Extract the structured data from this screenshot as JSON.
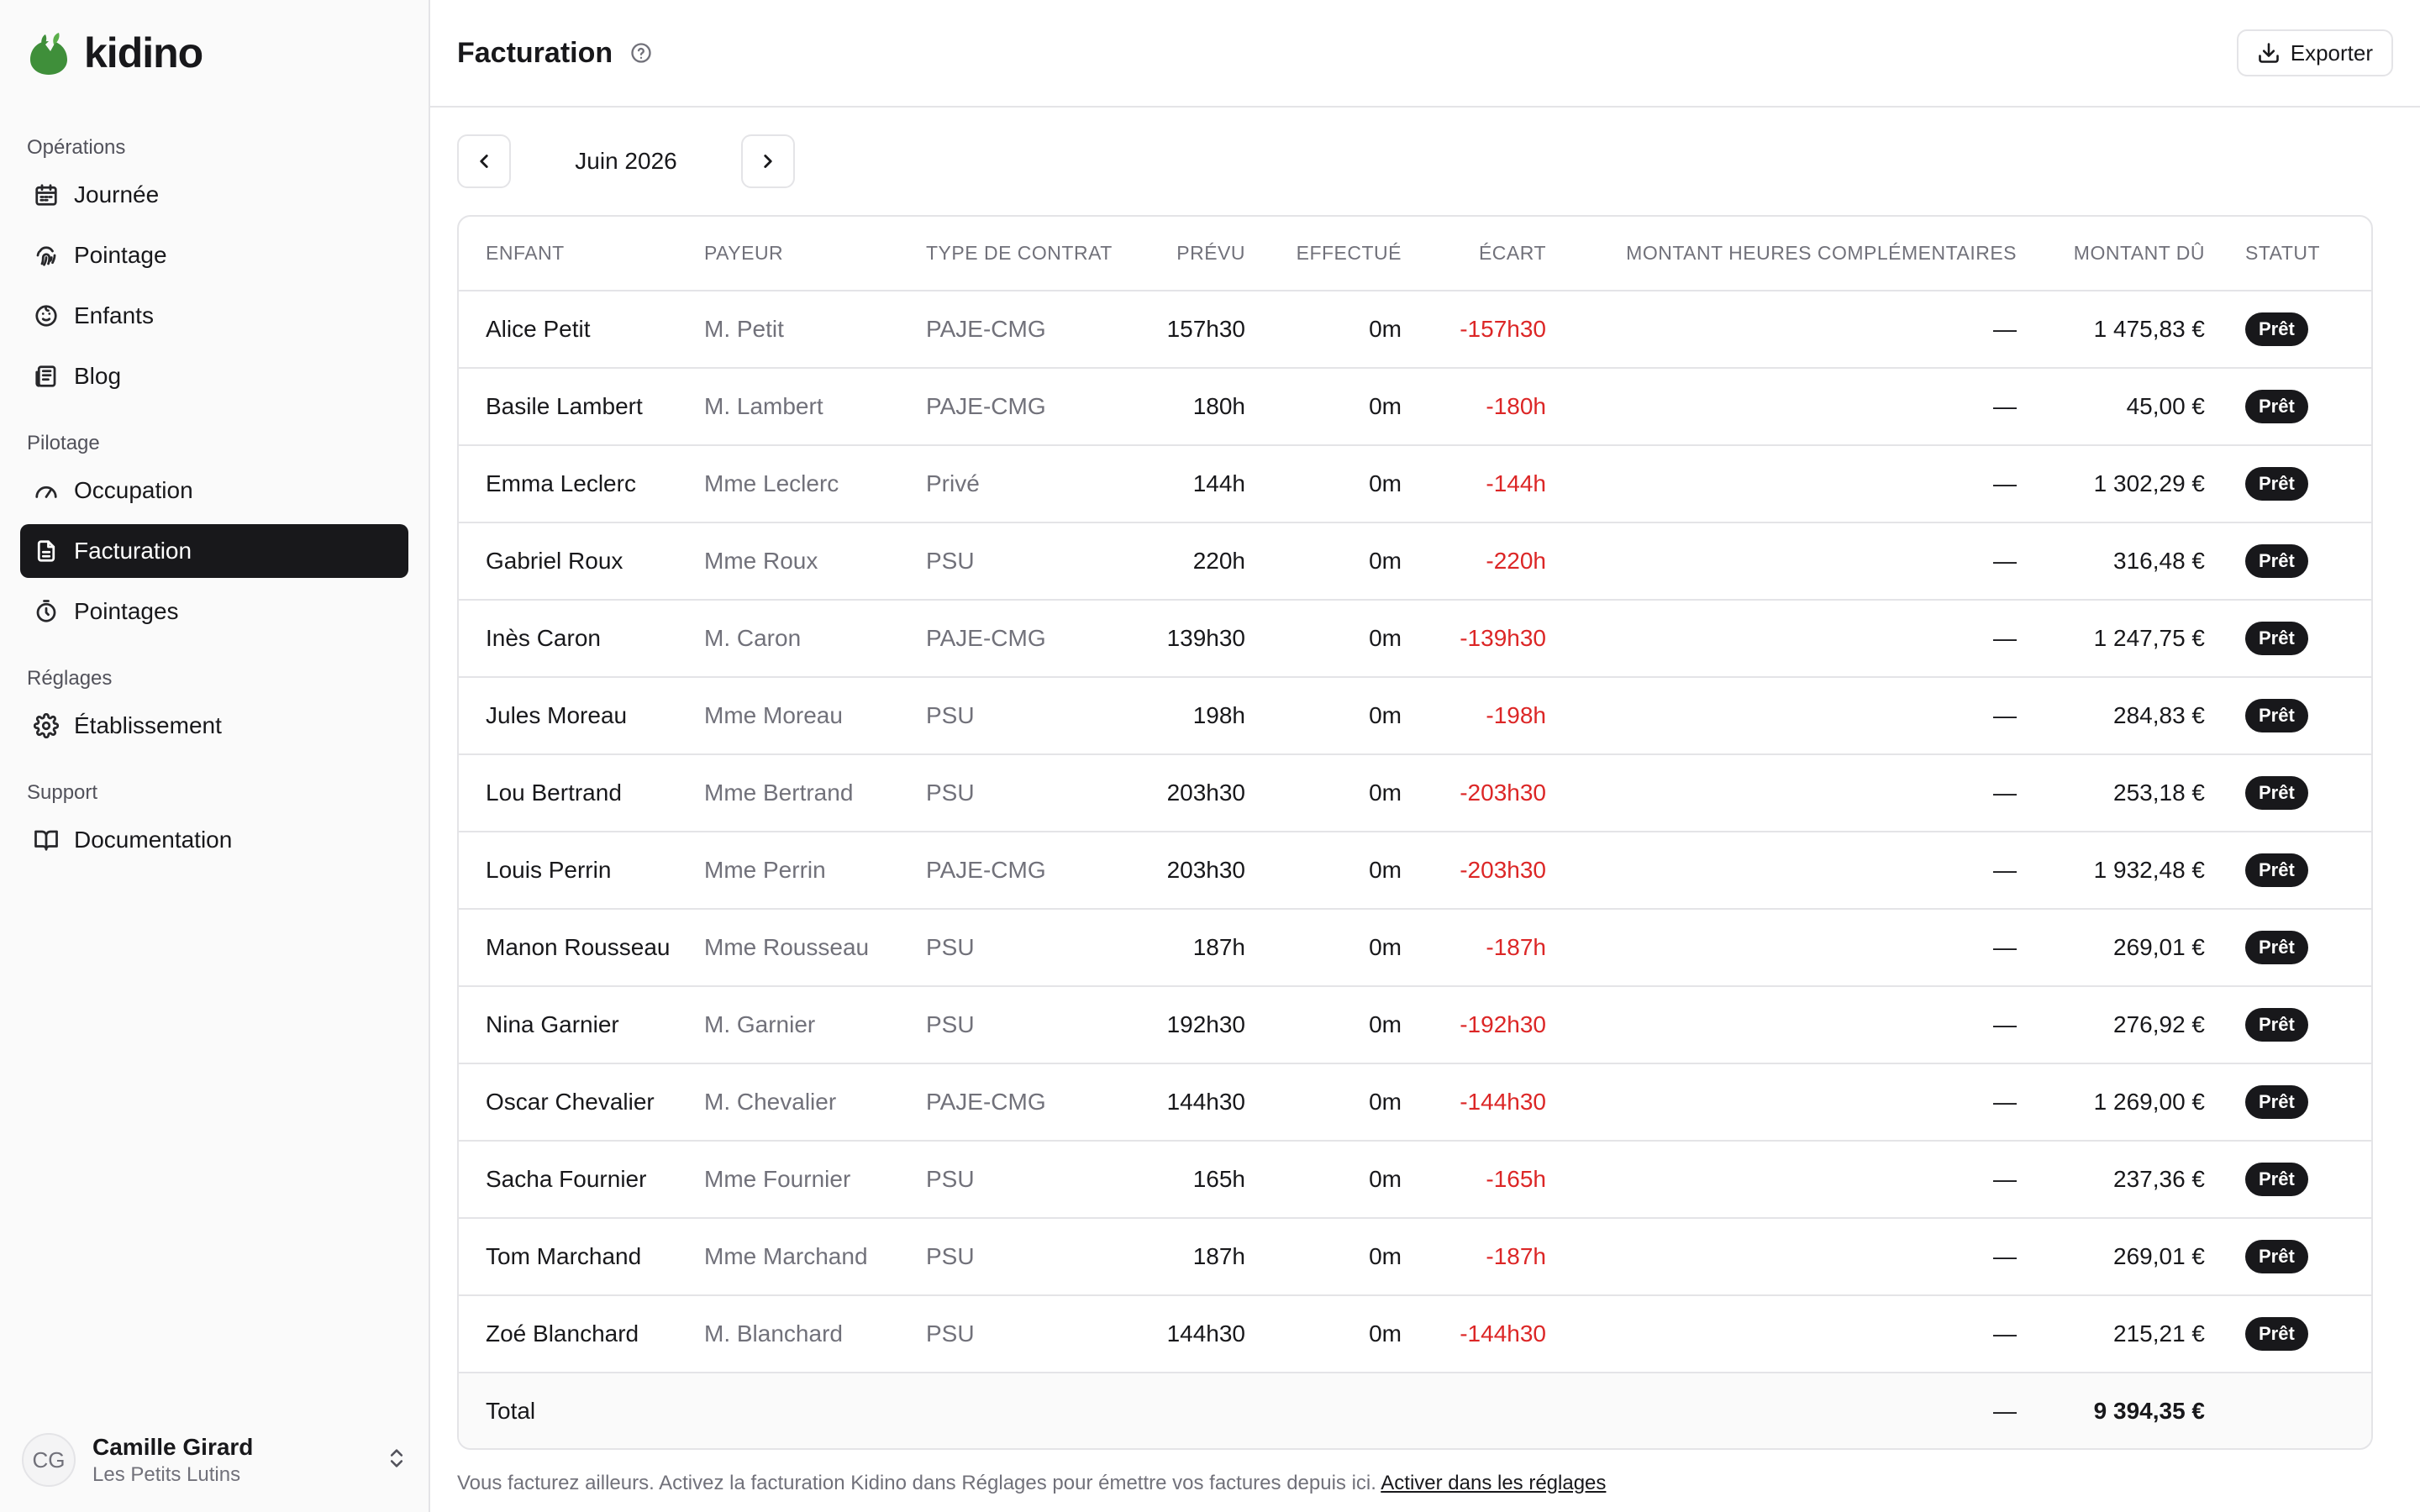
{
  "brand": {
    "name": "kidino",
    "color": "#3f8f3a"
  },
  "sidebar": {
    "sections": [
      {
        "label": "Opérations",
        "items": [
          {
            "label": "Journée",
            "icon": "calendar-icon"
          },
          {
            "label": "Pointage",
            "icon": "fingerprint-icon"
          },
          {
            "label": "Enfants",
            "icon": "baby-face-icon"
          },
          {
            "label": "Blog",
            "icon": "newspaper-icon"
          }
        ]
      },
      {
        "label": "Pilotage",
        "items": [
          {
            "label": "Occupation",
            "icon": "gauge-icon"
          },
          {
            "label": "Facturation",
            "icon": "document-icon",
            "active": true
          },
          {
            "label": "Pointages",
            "icon": "timer-icon"
          }
        ]
      },
      {
        "label": "Réglages",
        "items": [
          {
            "label": "Établissement",
            "icon": "gear-icon"
          }
        ]
      },
      {
        "label": "Support",
        "items": [
          {
            "label": "Documentation",
            "icon": "book-icon"
          }
        ]
      }
    ]
  },
  "user": {
    "initials": "CG",
    "name": "Camille Girard",
    "org": "Les Petits Lutins"
  },
  "header": {
    "title": "Facturation",
    "export_label": "Exporter"
  },
  "period": {
    "label": "Juin 2026"
  },
  "table": {
    "columns": [
      "Enfant",
      "Payeur",
      "Type de contrat",
      "Prévu",
      "Effectué",
      "Écart",
      "Montant heures complémentaires",
      "Montant dû",
      "Statut"
    ],
    "rows": [
      {
        "enfant": "Alice Petit",
        "payeur": "M. Petit",
        "type": "PAJE-CMG",
        "prevu": "157h30",
        "effectue": "0m",
        "ecart": "-157h30",
        "comp": "—",
        "du": "1 475,83 €",
        "statut": "Prêt"
      },
      {
        "enfant": "Basile Lambert",
        "payeur": "M. Lambert",
        "type": "PAJE-CMG",
        "prevu": "180h",
        "effectue": "0m",
        "ecart": "-180h",
        "comp": "—",
        "du": "45,00 €",
        "statut": "Prêt"
      },
      {
        "enfant": "Emma Leclerc",
        "payeur": "Mme Leclerc",
        "type": "Privé",
        "prevu": "144h",
        "effectue": "0m",
        "ecart": "-144h",
        "comp": "—",
        "du": "1 302,29 €",
        "statut": "Prêt"
      },
      {
        "enfant": "Gabriel Roux",
        "payeur": "Mme Roux",
        "type": "PSU",
        "prevu": "220h",
        "effectue": "0m",
        "ecart": "-220h",
        "comp": "—",
        "du": "316,48 €",
        "statut": "Prêt"
      },
      {
        "enfant": "Inès Caron",
        "payeur": "M. Caron",
        "type": "PAJE-CMG",
        "prevu": "139h30",
        "effectue": "0m",
        "ecart": "-139h30",
        "comp": "—",
        "du": "1 247,75 €",
        "statut": "Prêt"
      },
      {
        "enfant": "Jules Moreau",
        "payeur": "Mme Moreau",
        "type": "PSU",
        "prevu": "198h",
        "effectue": "0m",
        "ecart": "-198h",
        "comp": "—",
        "du": "284,83 €",
        "statut": "Prêt"
      },
      {
        "enfant": "Lou Bertrand",
        "payeur": "Mme Bertrand",
        "type": "PSU",
        "prevu": "203h30",
        "effectue": "0m",
        "ecart": "-203h30",
        "comp": "—",
        "du": "253,18 €",
        "statut": "Prêt"
      },
      {
        "enfant": "Louis Perrin",
        "payeur": "Mme Perrin",
        "type": "PAJE-CMG",
        "prevu": "203h30",
        "effectue": "0m",
        "ecart": "-203h30",
        "comp": "—",
        "du": "1 932,48 €",
        "statut": "Prêt"
      },
      {
        "enfant": "Manon Rousseau",
        "payeur": "Mme Rousseau",
        "type": "PSU",
        "prevu": "187h",
        "effectue": "0m",
        "ecart": "-187h",
        "comp": "—",
        "du": "269,01 €",
        "statut": "Prêt"
      },
      {
        "enfant": "Nina Garnier",
        "payeur": "M. Garnier",
        "type": "PSU",
        "prevu": "192h30",
        "effectue": "0m",
        "ecart": "-192h30",
        "comp": "—",
        "du": "276,92 €",
        "statut": "Prêt"
      },
      {
        "enfant": "Oscar Chevalier",
        "payeur": "M. Chevalier",
        "type": "PAJE-CMG",
        "prevu": "144h30",
        "effectue": "0m",
        "ecart": "-144h30",
        "comp": "—",
        "du": "1 269,00 €",
        "statut": "Prêt"
      },
      {
        "enfant": "Sacha Fournier",
        "payeur": "Mme Fournier",
        "type": "PSU",
        "prevu": "165h",
        "effectue": "0m",
        "ecart": "-165h",
        "comp": "—",
        "du": "237,36 €",
        "statut": "Prêt"
      },
      {
        "enfant": "Tom Marchand",
        "payeur": "Mme Marchand",
        "type": "PSU",
        "prevu": "187h",
        "effectue": "0m",
        "ecart": "-187h",
        "comp": "—",
        "du": "269,01 €",
        "statut": "Prêt"
      },
      {
        "enfant": "Zoé Blanchard",
        "payeur": "M. Blanchard",
        "type": "PSU",
        "prevu": "144h30",
        "effectue": "0m",
        "ecart": "-144h30",
        "comp": "—",
        "du": "215,21 €",
        "statut": "Prêt"
      }
    ],
    "total": {
      "label": "Total",
      "comp": "—",
      "du": "9 394,35 €"
    }
  },
  "footer": {
    "note": "Vous facturez ailleurs. Activez la facturation Kidino dans Réglages pour émettre vos factures depuis ici.",
    "link": "Activer dans les réglages"
  },
  "colors": {
    "accent": "#18181b",
    "negative": "#dc2626",
    "muted": "#71717a"
  }
}
